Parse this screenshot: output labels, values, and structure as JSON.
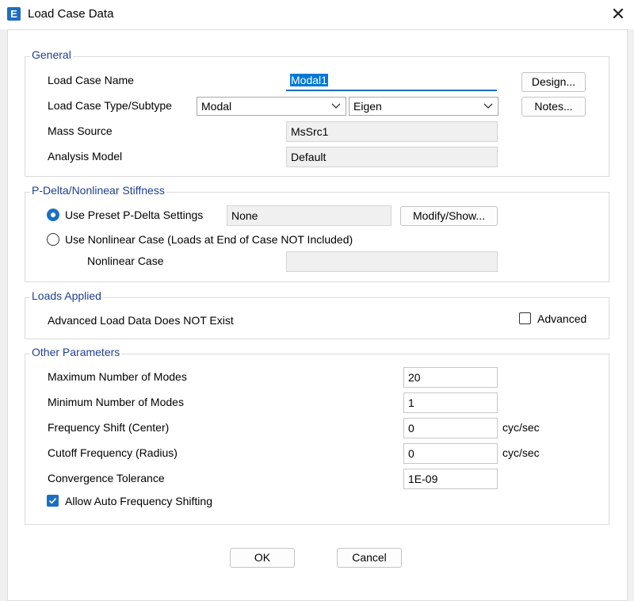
{
  "window": {
    "title": "Load Case Data",
    "icon_letter": "E",
    "close_glyph": "✕"
  },
  "general": {
    "label": "General",
    "name_label": "Load Case Name",
    "name_value": "Modal1",
    "type_label": "Load Case Type/Subtype",
    "type_value": "Modal",
    "subtype_value": "Eigen",
    "mass_label": "Mass Source",
    "mass_value": "MsSrc1",
    "model_label": "Analysis Model",
    "model_value": "Default",
    "design_btn": "Design...",
    "notes_btn": "Notes..."
  },
  "pdelta": {
    "label": "P-Delta/Nonlinear Stiffness",
    "preset_label": "Use Preset P-Delta Settings",
    "preset_value": "None",
    "modify_btn": "Modify/Show...",
    "nonlinear_label": "Use Nonlinear Case  (Loads at End of Case NOT Included)",
    "nonlinear_case_label": "Nonlinear Case",
    "nonlinear_case_value": "",
    "selected": "preset"
  },
  "loads": {
    "label": "Loads Applied",
    "status_text": "Advanced Load Data Does NOT Exist",
    "advanced_label": "Advanced",
    "advanced_checked": false
  },
  "other": {
    "label": "Other Parameters",
    "max_modes_label": "Maximum Number of Modes",
    "max_modes_value": "20",
    "min_modes_label": "Minimum Number of Modes",
    "min_modes_value": "1",
    "freq_shift_label": "Frequency Shift  (Center)",
    "freq_shift_value": "0",
    "freq_shift_unit": "cyc/sec",
    "cutoff_label": "Cutoff Frequency  (Radius)",
    "cutoff_value": "0",
    "cutoff_unit": "cyc/sec",
    "tolerance_label": "Convergence Tolerance",
    "tolerance_value": "1E-09",
    "auto_shift_label": "Allow Auto Frequency Shifting",
    "auto_shift_checked": true
  },
  "footer": {
    "ok_btn": "OK",
    "cancel_btn": "Cancel"
  },
  "colors": {
    "accent": "#1c6fc2",
    "group_label": "#1f3f8f"
  }
}
